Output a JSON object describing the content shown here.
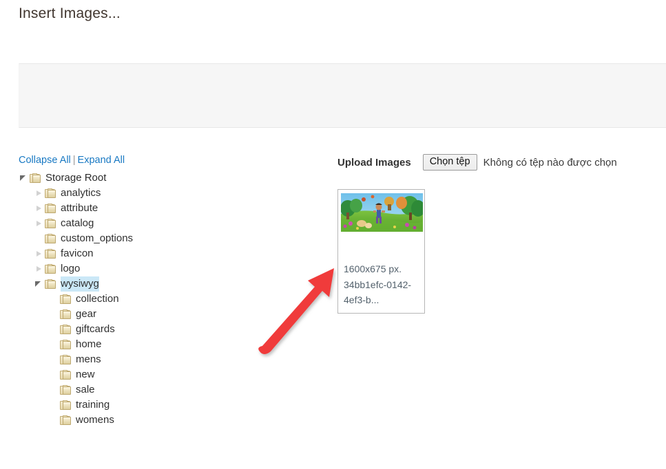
{
  "page": {
    "title": "Insert Images..."
  },
  "tree_actions": {
    "collapse_all": "Collapse All",
    "separator": "|",
    "expand_all": "Expand All"
  },
  "tree": {
    "root": {
      "label": "Storage Root",
      "level": 0,
      "state": "expanded",
      "selected": false
    },
    "items": [
      {
        "label": "analytics",
        "level": 1,
        "state": "collapsed",
        "selected": false
      },
      {
        "label": "attribute",
        "level": 1,
        "state": "collapsed",
        "selected": false
      },
      {
        "label": "catalog",
        "level": 1,
        "state": "collapsed",
        "selected": false
      },
      {
        "label": "custom_options",
        "level": 1,
        "state": "leaf",
        "selected": false
      },
      {
        "label": "favicon",
        "level": 1,
        "state": "collapsed",
        "selected": false
      },
      {
        "label": "logo",
        "level": 1,
        "state": "collapsed",
        "selected": false
      },
      {
        "label": "wysiwyg",
        "level": 1,
        "state": "expanded",
        "selected": true
      },
      {
        "label": "collection",
        "level": 2,
        "state": "leaf",
        "selected": false
      },
      {
        "label": "gear",
        "level": 2,
        "state": "leaf",
        "selected": false
      },
      {
        "label": "giftcards",
        "level": 2,
        "state": "leaf",
        "selected": false
      },
      {
        "label": "home",
        "level": 2,
        "state": "leaf",
        "selected": false
      },
      {
        "label": "mens",
        "level": 2,
        "state": "leaf",
        "selected": false
      },
      {
        "label": "new",
        "level": 2,
        "state": "leaf",
        "selected": false
      },
      {
        "label": "sale",
        "level": 2,
        "state": "leaf",
        "selected": false
      },
      {
        "label": "training",
        "level": 2,
        "state": "leaf",
        "selected": false
      },
      {
        "label": "womens",
        "level": 2,
        "state": "leaf",
        "selected": false
      }
    ]
  },
  "upload": {
    "label": "Upload Images",
    "choose_file_button": "Chọn tệp",
    "file_status": "Không có tệp nào được chọn"
  },
  "thumbnail": {
    "dimensions": "1600x675 px.",
    "filename_line1": "34bb1efc-0142-",
    "filename_line2": "4ef3-b..."
  },
  "annotation": {
    "arrow_color": "#f03b3b",
    "arrow_label": "red-arrow-pointing-to-thumbnail"
  },
  "colors": {
    "link": "#1979c3",
    "title_text": "#41362f",
    "selected_row": "#cbe8f7",
    "panel_bg": "#f6f6f6",
    "folder_icon": "#e6d7ac"
  }
}
